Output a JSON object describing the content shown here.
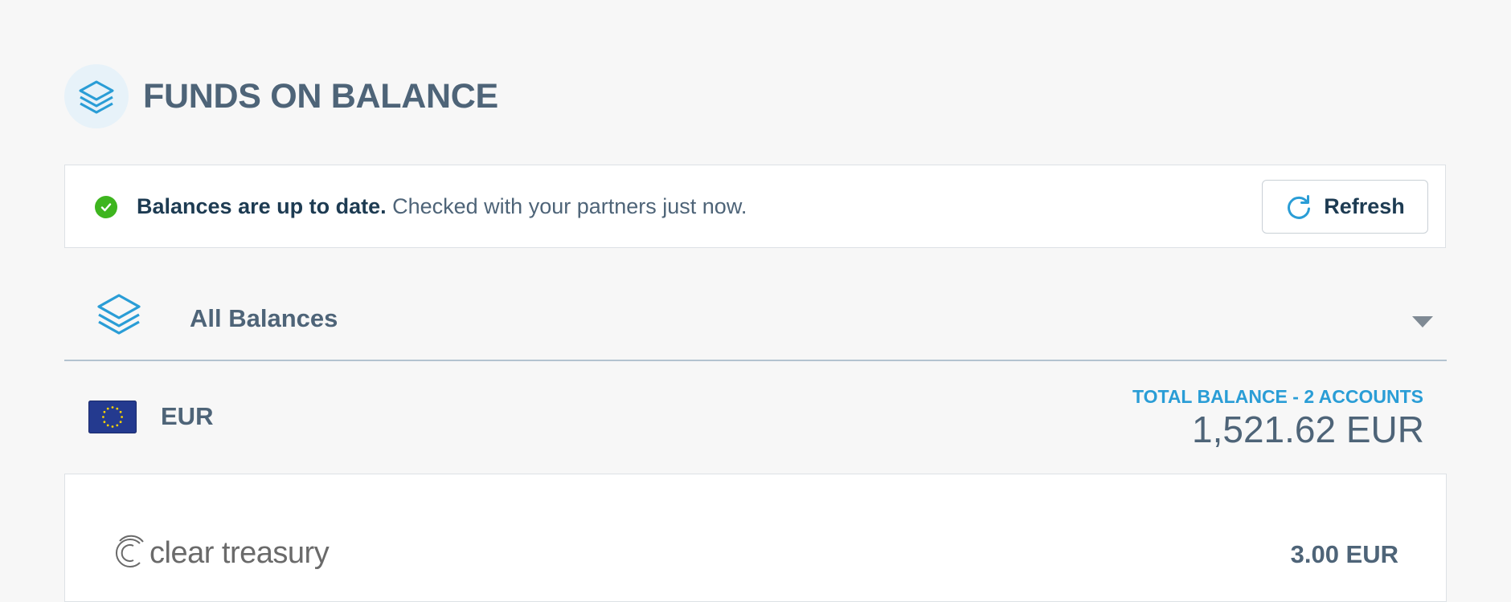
{
  "header": {
    "title": "FUNDS ON BALANCE",
    "icon": "layers-icon"
  },
  "status": {
    "icon": "check-circle-icon",
    "strong_text": "Balances are up to date.",
    "rest_text": " Checked with your partners just now.",
    "refresh_label": "Refresh",
    "refresh_icon": "refresh-icon"
  },
  "selector": {
    "icon": "layers-icon",
    "selected": "All Balances"
  },
  "currency": {
    "code": "EUR",
    "flag": "eu-flag-icon",
    "total_caption": "TOTAL BALANCE - 2 ACCOUNTS",
    "total_amount": "1,521.62 EUR"
  },
  "accounts": [
    {
      "partner": "clear treasury",
      "amount": "3.00 EUR"
    }
  ],
  "colors": {
    "accent": "#2a9dd6",
    "success": "#3eb51f",
    "text": "#4e6478",
    "dark_text": "#1d3b52"
  }
}
